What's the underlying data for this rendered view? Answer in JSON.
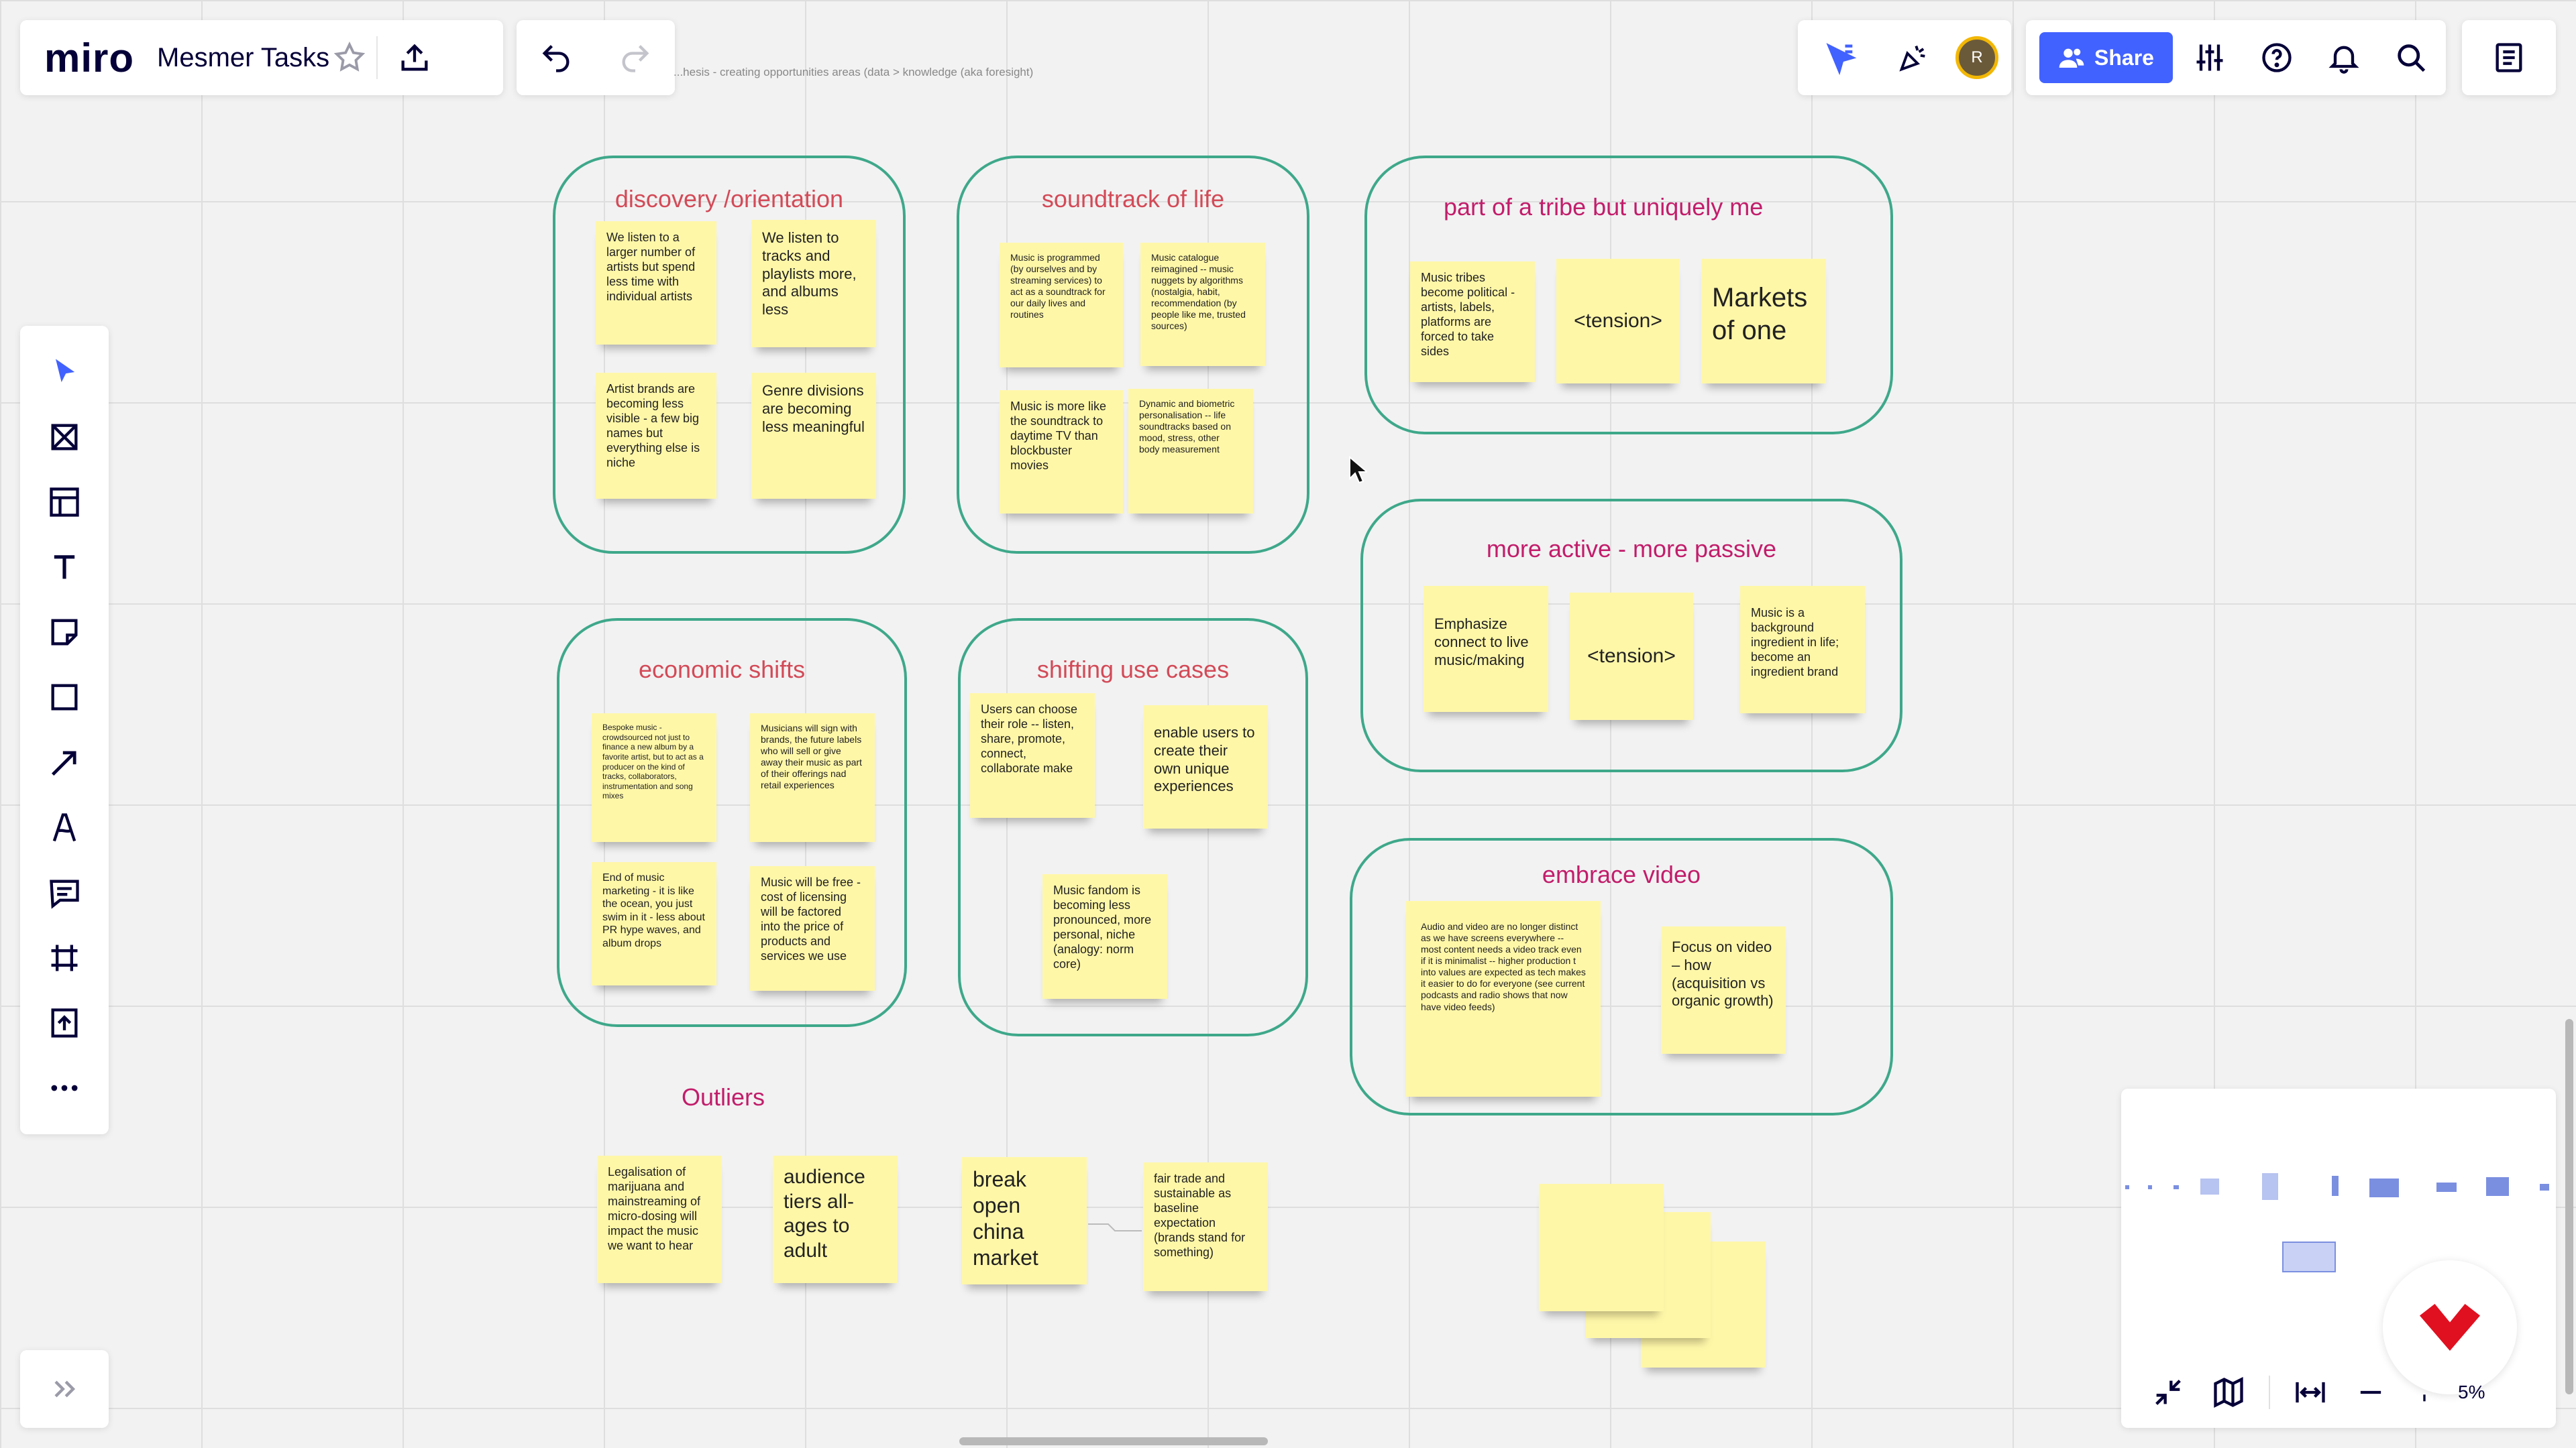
{
  "app": {
    "logo": "miro",
    "board_title": "Mesmer Tasks",
    "breadcrumb": "...hesis - creating opportunities areas (data > knowledge (aka foresight)"
  },
  "top_right": {
    "share_label": "Share",
    "avatar_initial": "R"
  },
  "zoom": {
    "level": "5%"
  },
  "colors": {
    "accent": "#4262ff",
    "frame_border": "#3ea88a",
    "sticky": "#fff7a8",
    "title_red": "#d34a57",
    "title_magenta": "#c21d6b",
    "logo_red": "#e01020"
  },
  "frames": {
    "discovery": {
      "title": "discovery /orientation",
      "notes": [
        "We listen to a larger number of artists but spend less time with individual artists",
        "We listen to tracks and playlists more, and albums less",
        "Artist brands are becoming less visible - a few big names but everything else is niche",
        "Genre divisions are becoming less meaningful"
      ]
    },
    "soundtrack": {
      "title": "soundtrack of life",
      "notes": [
        "Music is programmed (by ourselves and by streaming services) to act as a soundtrack for our daily lives and routines",
        "Music catalogue reimagined -- music nuggets by algorithms (nostalgia, habit, recommendation (by people like me, trusted sources)",
        "Music is more like the soundtrack to daytime TV than blockbuster movies",
        "Dynamic and biometric personalisation -- life soundtracks based on mood, stress, other body measurement"
      ]
    },
    "tribe": {
      "title": "part of a tribe but uniquely me",
      "notes": [
        "Music tribes become political - artists, labels, platforms are forced to take sides",
        "<tension>",
        "Markets of one"
      ]
    },
    "active": {
      "title": "more active - more passive",
      "notes": [
        "Emphasize connect to live music/making",
        "<tension>",
        "Music is a background ingredient in life; become an ingredient brand"
      ]
    },
    "economic": {
      "title": "economic shifts",
      "notes": [
        "Bespoke music - crowdsourced not just to finance a new album by a favorite artist, but to act as a producer on the kind of tracks, collaborators, instrumentation and song mixes",
        "Musicians will sign with brands, the future labels who will sell or give away their music as part of their offerings nad retail experiences",
        "End of music marketing - it is like the ocean, you just swim in it - less about PR hype waves, and album drops",
        "Music will be free - cost of licensing will be factored into the price of products and services we use"
      ]
    },
    "shifting": {
      "title": "shifting use cases",
      "notes": [
        "Users can choose their role -- listen, share, promote, connect, collaborate make",
        "enable users to create their own unique experiences",
        "Music fandom is becoming less pronounced, more personal, niche (analogy: norm core)"
      ]
    },
    "video": {
      "title": "embrace video",
      "notes": [
        "Audio and video are no longer distinct as we have screens everywhere -- most content needs a video track even if it is minimalist -- higher production t into values are expected as tech makes it easier to do for everyone (see current podcasts and radio shows that now have video feeds)",
        "Focus on video – how (acquisition vs organic growth)"
      ]
    },
    "outliers": {
      "title": "Outliers",
      "notes": [
        "Legalisation of marijuana and mainstreaming of micro-dosing will impact the music we want to hear",
        "audience tiers all-ages to adult",
        "break open china market",
        "fair trade and sustainable as baseline expectation (brands stand for something)"
      ]
    }
  }
}
